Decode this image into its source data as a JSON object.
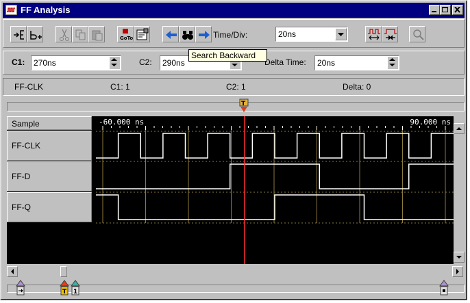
{
  "window": {
    "title": "FF Analysis"
  },
  "toolbar": {
    "time_div_label": "Time/Div:",
    "time_div_value": "20ns",
    "tooltip": "Search Backward"
  },
  "cursors": {
    "c1_label": "C1:",
    "c1_value": "270ns",
    "c2_label": "C2:",
    "c2_value": "290ns",
    "delta_label": "Delta Time:",
    "delta_value": "20ns"
  },
  "readout": {
    "signal": "FF-CLK",
    "c1": "C1: 1",
    "c2": "C2: 1",
    "delta": "Delta: 0"
  },
  "waveform": {
    "sample_label": "Sample",
    "time_start": "-60.000 ns",
    "time_end": "90.000 ns",
    "signals": [
      {
        "name": "FF-CLK",
        "levels": [
          0,
          1,
          0,
          1,
          0,
          1,
          0,
          1,
          0,
          1,
          0,
          1,
          0,
          1,
          0,
          1
        ]
      },
      {
        "name": "FF-D",
        "levels": [
          0,
          0,
          0,
          0,
          0,
          0,
          1,
          1,
          1,
          1,
          0,
          0,
          0,
          0,
          1,
          1
        ]
      },
      {
        "name": "FF-Q",
        "levels": [
          1,
          0,
          0,
          0,
          0,
          0,
          0,
          0,
          1,
          1,
          1,
          1,
          0,
          0,
          0,
          0
        ]
      }
    ]
  },
  "colors": {
    "cursor": "#ff3030",
    "waveform": "#ffffff",
    "grid": "#8a7a3a",
    "title_bar": "#000080",
    "arrow": "#1e5fd0"
  }
}
